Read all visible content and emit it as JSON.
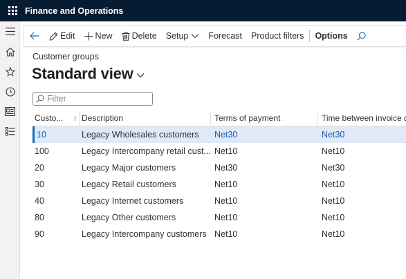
{
  "app": {
    "title": "Finance and Operations"
  },
  "navrail": [
    {
      "name": "hamburger-icon"
    },
    {
      "name": "home-icon"
    },
    {
      "name": "favorites-star-icon"
    },
    {
      "name": "recent-clock-icon"
    },
    {
      "name": "workspaces-icon"
    },
    {
      "name": "modules-list-icon"
    }
  ],
  "actionpane": {
    "edit": "Edit",
    "new": "New",
    "delete": "Delete",
    "setup": "Setup",
    "forecast": "Forecast",
    "product_filters": "Product filters",
    "options": "Options"
  },
  "page": {
    "breadcrumb": "Customer groups",
    "view_title": "Standard view"
  },
  "filter": {
    "placeholder": "Filter",
    "value": ""
  },
  "grid": {
    "columns": [
      "Custo...",
      "Description",
      "Terms of payment",
      "Time between invoice du"
    ],
    "sort_indicator": "↑",
    "rows": [
      {
        "group": "10",
        "description": "Legacy Wholesales customers",
        "terms": "Net30",
        "time": "Net30",
        "selected": true
      },
      {
        "group": "100",
        "description": "Legacy Intercompany retail cust...",
        "terms": "Net10",
        "time": "Net10",
        "selected": false
      },
      {
        "group": "20",
        "description": "Legacy Major customers",
        "terms": "Net30",
        "time": "Net30",
        "selected": false
      },
      {
        "group": "30",
        "description": "Legacy Retail customers",
        "terms": "Net10",
        "time": "Net10",
        "selected": false
      },
      {
        "group": "40",
        "description": "Legacy Internet customers",
        "terms": "Net10",
        "time": "Net10",
        "selected": false
      },
      {
        "group": "80",
        "description": "Legacy Other customers",
        "terms": "Net10",
        "time": "Net10",
        "selected": false
      },
      {
        "group": "90",
        "description": "Legacy Intercompany  customers",
        "terms": "Net10",
        "time": "Net10",
        "selected": false
      }
    ]
  },
  "colors": {
    "appbar": "#071b33",
    "accent": "#0f6cbd",
    "selected_row": "#dfe9f7",
    "link_blue": "#1b5fab"
  }
}
